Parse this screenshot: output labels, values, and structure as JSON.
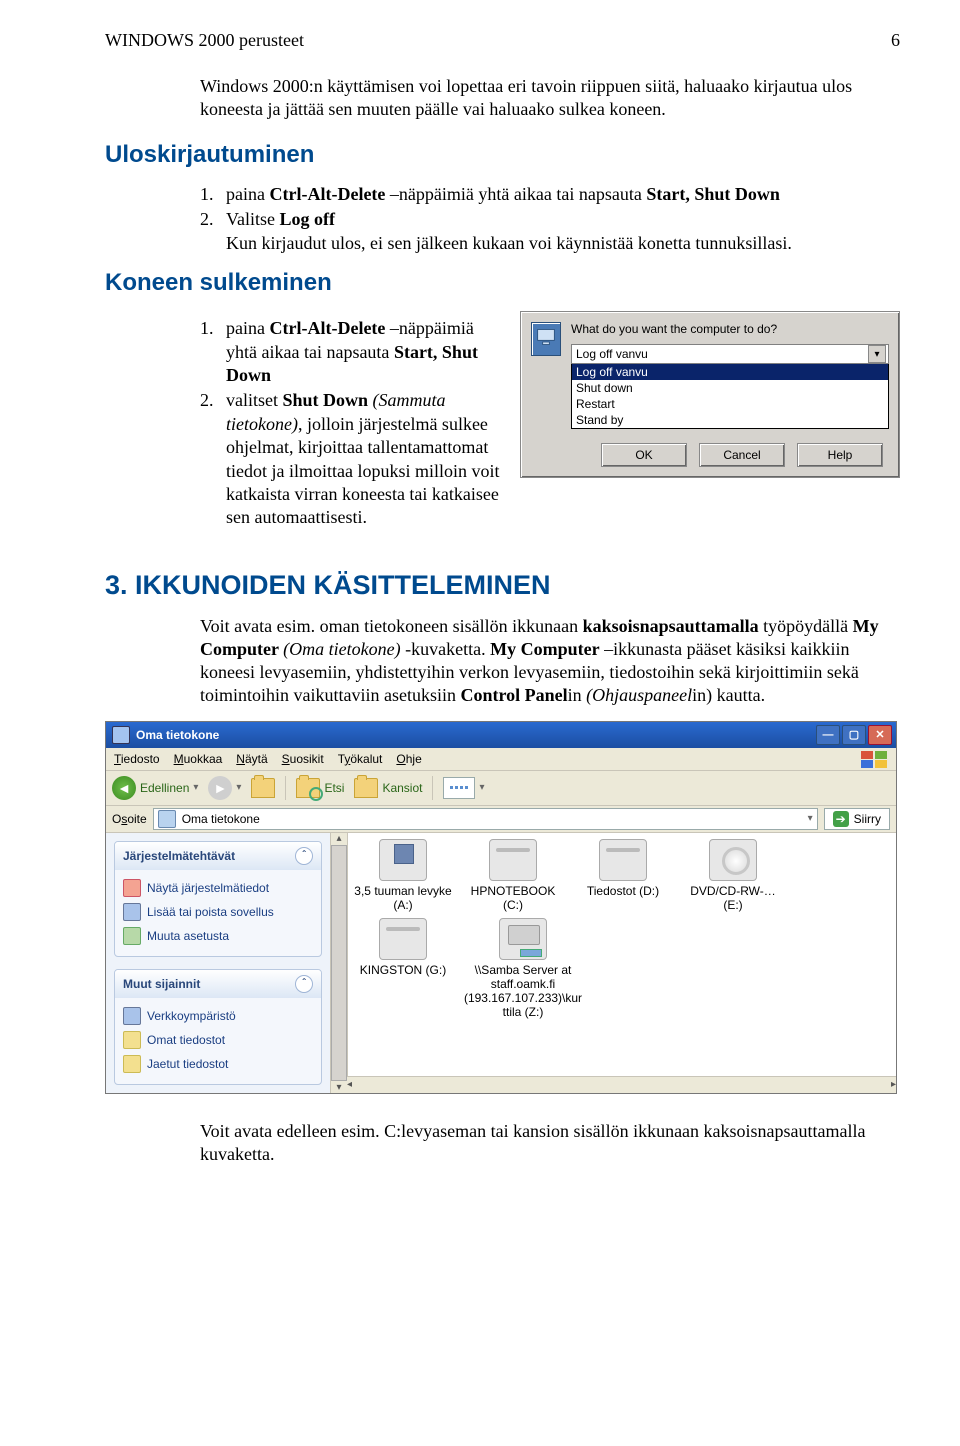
{
  "header": {
    "left": "WINDOWS 2000 perusteet",
    "right": "6"
  },
  "intro": "Windows 2000:n käyttämisen voi lopettaa eri tavoin riippuen siitä, haluaako kirjautua ulos koneesta ja jättää sen muuten päälle vai haluaako sulkea koneen.",
  "h1": "Uloskirjautuminen",
  "list1": {
    "i1": {
      "n": "1.",
      "a": "paina ",
      "b": "Ctrl-Alt-Delete",
      "c": " –näppäimiä yhtä aikaa  tai  napsauta ",
      "d": "Start, Shut Down"
    },
    "i2": {
      "n": "2.",
      "a": "Valitse  ",
      "b": "Log off"
    },
    "i2b": "Kun kirjaudut ulos, ei sen jälkeen kukaan voi käynnistää konetta tunnuksillasi."
  },
  "h2": "Koneen sulkeminen",
  "list2": {
    "i1": {
      "n": "1.",
      "a": "paina ",
      "b": "Ctrl-Alt-Delete",
      "c": " –näppäimiä yhtä aikaa  tai  napsauta ",
      "d": "Start, Shut Down"
    },
    "i2": {
      "n": "2.",
      "a": "valitset  ",
      "b": "Shut Down ",
      "c": "(Sammuta tietokone)",
      "d": ", jolloin järjestelmä sulkee ohjelmat, kirjoittaa tallentamattomat tiedot ja ilmoittaa lopuksi milloin voit katkaista virran koneesta tai katkaisee sen automaattisesti."
    }
  },
  "dialog": {
    "q": "What do you want the computer to do?",
    "selected": "Log off vanvu",
    "opts": [
      "Log off vanvu",
      "Shut down",
      "Restart",
      "Stand by"
    ],
    "ok": "OK",
    "cancel": "Cancel",
    "help": "Help"
  },
  "h3": "3. IKKUNOIDEN KÄSITTELEMINEN",
  "p3": {
    "a": "Voit avata esim. oman tietokoneen sisällön ikkunaan ",
    "b": "kaksoisnapsauttamalla",
    "c": " työpöydällä ",
    "d": "My Computer ",
    "e": "(Oma tietokone) ",
    "f": "-kuvaketta. ",
    "g": "My Computer",
    "h": " –ikkunasta pääset käsiksi kaikkiin koneesi levyasemiin, yhdistettyihin verkon levyasemiin, tiedostoihin sekä kirjoittimiin sekä toimintoihin vaikuttaviin asetuksiin ",
    "i": "Control Panel",
    "j": "in ",
    "k": "(Ohjauspaneel",
    "l": "in) kautta."
  },
  "explorer": {
    "title": "Oma tietokone",
    "menu": [
      "Tiedosto",
      "Muokkaa",
      "Näytä",
      "Suosikit",
      "Työkalut",
      "Ohje"
    ],
    "toolbar": {
      "back": "Edellinen",
      "fwd_drop": "▾",
      "search": "Etsi",
      "folders": "Kansiot"
    },
    "addr_label": "Osoite",
    "addr_value": "Oma tietokone",
    "go": "Siirry",
    "panel1": {
      "title": "Järjestelmätehtävät",
      "items": [
        "Näytä järjestelmätiedot",
        "Lisää tai poista sovellus",
        "Muuta asetusta"
      ]
    },
    "panel2": {
      "title": "Muut sijainnit",
      "items": [
        "Verkkoympäristö",
        "Omat tiedostot",
        "Jaetut tiedostot"
      ]
    },
    "drives": [
      {
        "label": "3,5 tuuman levyke (A:)"
      },
      {
        "label": "HPNOTEBOOK (C:)"
      },
      {
        "label": "Tiedostot (D:)"
      },
      {
        "label": "DVD/CD-RW-… (E:)"
      },
      {
        "label": "KINGSTON (G:)"
      },
      {
        "label": "\\\\Samba Server at staff.oamk.fi (193.167.107.233)\\kurttila (Z:)"
      }
    ]
  },
  "tail": "Voit avata edelleen esim. C:levyaseman tai kansion sisällön ikkunaan kaksoisnapsauttamalla kuvaketta."
}
